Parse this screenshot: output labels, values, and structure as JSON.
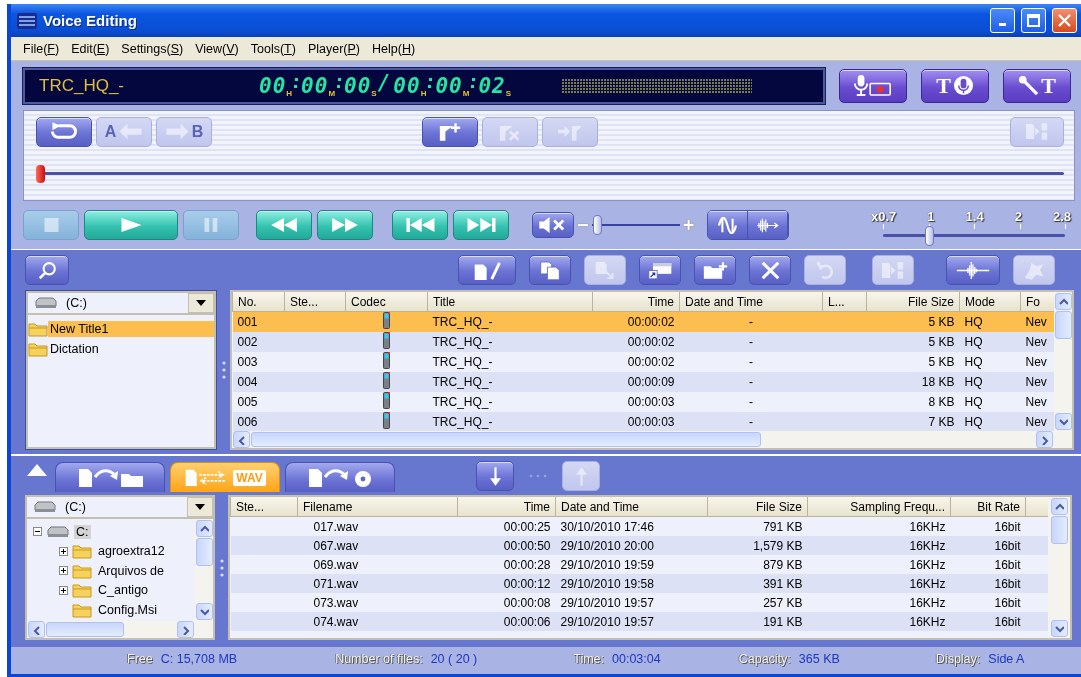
{
  "window": {
    "title": "Voice Editing"
  },
  "menu": [
    {
      "label": "File(F)"
    },
    {
      "label": "Edit(E)"
    },
    {
      "label": "Settings(S)"
    },
    {
      "label": "View(V)"
    },
    {
      "label": "Tools(T)"
    },
    {
      "label": "Player(P)"
    },
    {
      "label": "Help(H)"
    }
  ],
  "player": {
    "display": {
      "title": "TRC_HQ_-",
      "position": [
        {
          "value": "00",
          "unit": "H"
        },
        {
          "value": "00",
          "unit": "M"
        },
        {
          "value": "00",
          "unit": "S"
        }
      ],
      "separator": "/",
      "duration": [
        {
          "value": "00",
          "unit": "H"
        },
        {
          "value": "00",
          "unit": "M"
        },
        {
          "value": "02",
          "unit": "S"
        }
      ]
    },
    "record_buttons": [
      {
        "kind": "mic-record"
      },
      {
        "kind": "text-to-mic",
        "label": "T"
      },
      {
        "kind": "mic-to-text",
        "label": "T"
      }
    ],
    "marker_groups": [
      {
        "buttons": [
          {
            "kind": "repeat",
            "disabled": false
          },
          {
            "kind": "a-point",
            "label": "A",
            "disabled": true
          },
          {
            "kind": "b-point",
            "label": "B",
            "disabled": true
          }
        ]
      },
      {
        "buttons": [
          {
            "kind": "add-marker",
            "disabled": false
          },
          {
            "kind": "delete-marker",
            "disabled": true
          },
          {
            "kind": "go-marker",
            "disabled": true
          }
        ]
      },
      {
        "buttons": [
          {
            "kind": "split",
            "disabled": true
          }
        ]
      }
    ],
    "position": {
      "level": 0
    },
    "transport": [
      {
        "kind": "stop",
        "disabled": true
      },
      {
        "kind": "play",
        "disabled": false
      },
      {
        "kind": "pause",
        "disabled": true
      },
      {
        "kind": "rewind",
        "disabled": false
      },
      {
        "kind": "fast-forward",
        "disabled": false
      },
      {
        "kind": "previous",
        "disabled": false
      },
      {
        "kind": "next",
        "disabled": false
      }
    ],
    "volume": {
      "minus": "−",
      "plus": "+",
      "level": 0.06
    },
    "sound_buttons": [
      {
        "kind": "mute"
      },
      {
        "kind": "noise-cancel"
      },
      {
        "kind": "voice-filter"
      }
    ],
    "speed": {
      "ticks": [
        "x0.7",
        "1",
        "1.4",
        "2",
        "2.8"
      ],
      "level": 0.25
    }
  },
  "library": {
    "toolbar": [
      {
        "kind": "edit",
        "disabled": false
      },
      {
        "kind": "copy",
        "disabled": false
      },
      {
        "kind": "move",
        "disabled": true
      },
      {
        "kind": "shortcut",
        "disabled": false
      },
      {
        "kind": "new-folder",
        "disabled": false
      },
      {
        "kind": "delete",
        "disabled": false
      },
      {
        "kind": "undo",
        "disabled": true
      },
      {
        "kind": "split",
        "disabled": true
      },
      {
        "kind": "wave",
        "disabled": false
      },
      {
        "kind": "dragon",
        "disabled": true
      }
    ],
    "drive": "(C:)",
    "folders": [
      {
        "label": "New Title1",
        "selected": true
      },
      {
        "label": "Dictation",
        "selected": false
      }
    ],
    "columns": [
      "No.",
      "Ste...",
      "Codec",
      "Title",
      "Time",
      "Date and Time",
      "L...",
      "File Size",
      "Mode",
      "Fo"
    ],
    "rows": [
      {
        "no": "001",
        "title": "TRC_HQ_-",
        "time": "00:00:02",
        "date_time": "-",
        "file_size": "5 KB",
        "mode": "HQ",
        "column_10": "Nev",
        "selected": true
      },
      {
        "no": "002",
        "title": "TRC_HQ_-",
        "time": "00:00:02",
        "date_time": "-",
        "file_size": "5 KB",
        "mode": "HQ",
        "column_10": "Nev",
        "selected": false
      },
      {
        "no": "003",
        "title": "TRC_HQ_-",
        "time": "00:00:02",
        "date_time": "-",
        "file_size": "5 KB",
        "mode": "HQ",
        "column_10": "Nev",
        "selected": false
      },
      {
        "no": "004",
        "title": "TRC_HQ_-",
        "time": "00:00:09",
        "date_time": "-",
        "file_size": "18 KB",
        "mode": "HQ",
        "column_10": "Nev",
        "selected": false
      },
      {
        "no": "005",
        "title": "TRC_HQ_-",
        "time": "00:00:03",
        "date_time": "-",
        "file_size": "8 KB",
        "mode": "HQ",
        "column_10": "Nev",
        "selected": false
      },
      {
        "no": "006",
        "title": "TRC_HQ_-",
        "time": "00:00:03",
        "date_time": "-",
        "file_size": "7 KB",
        "mode": "HQ",
        "column_10": "Nev",
        "selected": false
      }
    ]
  },
  "converter": {
    "tabs": [
      {
        "kind": "to-folder",
        "selected": false
      },
      {
        "kind": "convert",
        "label": "WAV",
        "selected": true
      },
      {
        "kind": "to-disc",
        "selected": false
      }
    ],
    "transfer": [
      {
        "kind": "down",
        "disabled": false
      },
      {
        "kind": "up",
        "disabled": true
      }
    ],
    "drive": "(C:)",
    "tree": {
      "label": "C:",
      "expanded": true,
      "selected": true,
      "children": [
        {
          "label": "agroextra12",
          "expandable": true
        },
        {
          "label": "Arquivos de",
          "expandable": true
        },
        {
          "label": "C_antigo",
          "expandable": true
        },
        {
          "label": "Config.Msi",
          "expandable": false
        }
      ]
    },
    "columns": [
      "Ste...",
      "Filename",
      "Time",
      "Date and Time",
      "File Size",
      "Sampling Frequ...",
      "Bit Rate"
    ],
    "rows": [
      {
        "filename": "017.wav",
        "time": "00:00:25",
        "date_time": "30/10/2010 17:46",
        "file_size": "791 KB",
        "sampling": "16KHz",
        "bit_rate": "16bit"
      },
      {
        "filename": "067.wav",
        "time": "00:00:50",
        "date_time": "29/10/2010 20:00",
        "file_size": "1,579 KB",
        "sampling": "16KHz",
        "bit_rate": "16bit"
      },
      {
        "filename": "069.wav",
        "time": "00:00:28",
        "date_time": "29/10/2010 19:59",
        "file_size": "879 KB",
        "sampling": "16KHz",
        "bit_rate": "16bit"
      },
      {
        "filename": "071.wav",
        "time": "00:00:12",
        "date_time": "29/10/2010 19:58",
        "file_size": "391 KB",
        "sampling": "16KHz",
        "bit_rate": "16bit"
      },
      {
        "filename": "073.wav",
        "time": "00:00:08",
        "date_time": "29/10/2010 19:57",
        "file_size": "257 KB",
        "sampling": "16KHz",
        "bit_rate": "16bit"
      },
      {
        "filename": "074.wav",
        "time": "00:00:06",
        "date_time": "29/10/2010 19:57",
        "file_size": "191 KB",
        "sampling": "16KHz",
        "bit_rate": "16bit"
      }
    ]
  },
  "status_bar": [
    {
      "label": "Free",
      "value": "C: 15,708 MB"
    },
    {
      "label": "Number of files:",
      "value": "20 ( 20 )"
    },
    {
      "label": "Time:",
      "value": "00:03:04"
    },
    {
      "label": "Capacity:",
      "value": "365 KB"
    },
    {
      "label": "Display:",
      "value": "Side A"
    }
  ]
}
